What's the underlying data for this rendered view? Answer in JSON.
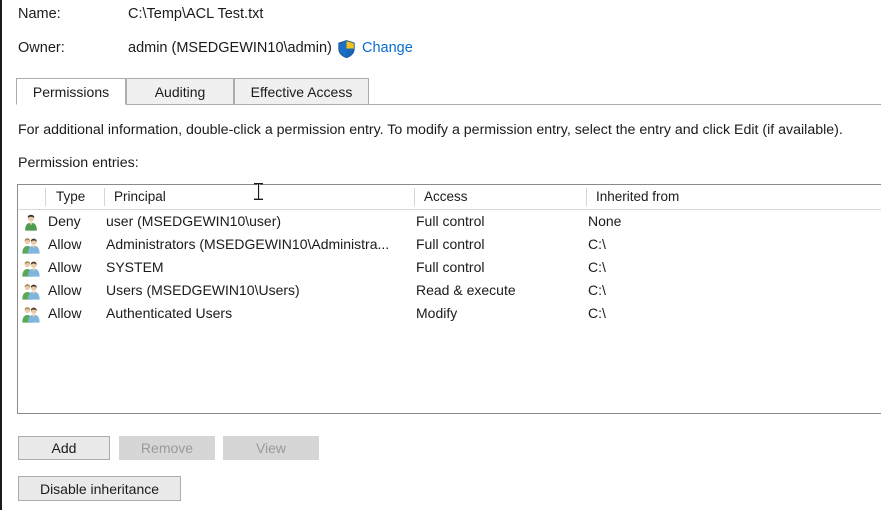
{
  "header": {
    "name_label": "Name:",
    "name_value": "C:\\Temp\\ACL Test.txt",
    "owner_label": "Owner:",
    "owner_value": "admin (MSEDGEWIN10\\admin)",
    "change_link": "Change",
    "shield_icon": "uac-shield-icon"
  },
  "tabs": [
    {
      "label": "Permissions",
      "active": true
    },
    {
      "label": "Auditing",
      "active": false
    },
    {
      "label": "Effective Access",
      "active": false
    }
  ],
  "body": {
    "info_text": "For additional information, double-click a permission entry. To modify a permission entry, select the entry and click Edit (if available).",
    "entries_label": "Permission entries:"
  },
  "table": {
    "columns": [
      "",
      "Type",
      "Principal",
      "Access",
      "Inherited from"
    ],
    "rows": [
      {
        "icon": "user-icon",
        "type": "Deny",
        "principal": "user (MSEDGEWIN10\\user)",
        "access": "Full control",
        "inherited_from": "None"
      },
      {
        "icon": "group-icon",
        "type": "Allow",
        "principal": "Administrators (MSEDGEWIN10\\Administra...",
        "access": "Full control",
        "inherited_from": "C:\\"
      },
      {
        "icon": "group-icon",
        "type": "Allow",
        "principal": "SYSTEM",
        "access": "Full control",
        "inherited_from": "C:\\"
      },
      {
        "icon": "group-icon",
        "type": "Allow",
        "principal": "Users (MSEDGEWIN10\\Users)",
        "access": "Read & execute",
        "inherited_from": "C:\\"
      },
      {
        "icon": "group-icon",
        "type": "Allow",
        "principal": "Authenticated Users",
        "access": "Modify",
        "inherited_from": "C:\\"
      }
    ]
  },
  "buttons": {
    "add": "Add",
    "remove": "Remove",
    "view": "View",
    "disable_inheritance": "Disable inheritance"
  },
  "colors": {
    "link": "#0a6cce",
    "shield_blue": "#1d6fc4",
    "shield_gold": "#f0c419",
    "text": "#1b1b1b",
    "disabled_text": "#9a9a9a",
    "border": "#8a8a8a",
    "button_face": "#e9e9e9"
  }
}
